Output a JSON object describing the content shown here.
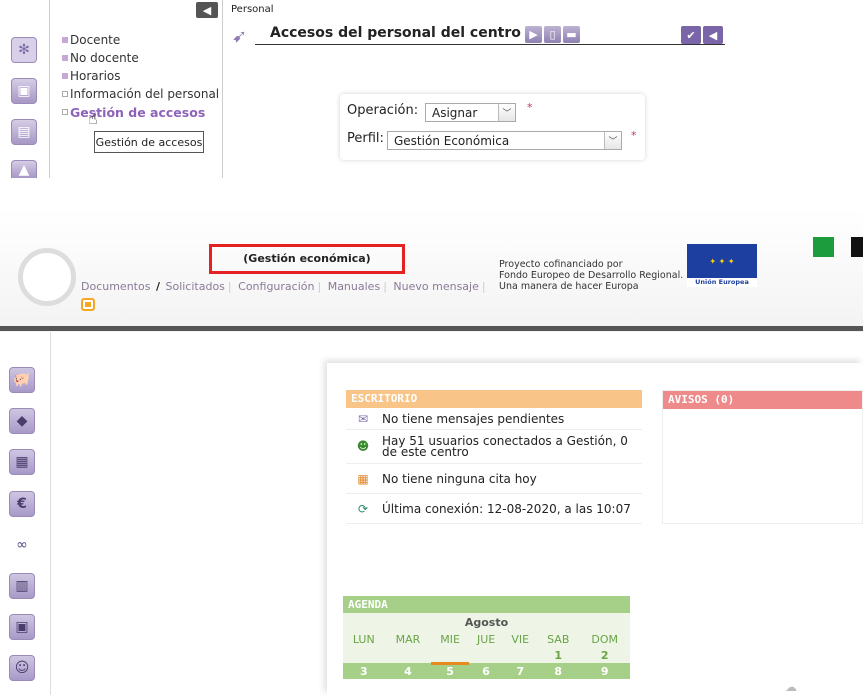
{
  "top": {
    "section": "Personal",
    "title": "Accesos del personal del centro",
    "menu": [
      {
        "label": "Docente",
        "color": "#c7a7d6"
      },
      {
        "label": "No docente",
        "color": "#c7a7d6"
      },
      {
        "label": "Horarios",
        "color": "#c7a7d6"
      },
      {
        "label": "Información del personal",
        "color": "#ffffff"
      },
      {
        "label": "Gestión de accesos",
        "color": "#ffffff",
        "active": true
      }
    ],
    "tooltip": "Gestión de accesos",
    "form": {
      "operacion_label": "Operación:",
      "operacion_value": "Asignar",
      "perfil_label": "Perfil:",
      "perfil_value": "Gestión Económica",
      "required_mark": "*"
    },
    "toolbar_icons": [
      "arrow-right-icon",
      "document-icon",
      "print-icon"
    ],
    "action_icons": [
      "check-icon",
      "back-icon"
    ],
    "left_icons": [
      "virus-icon",
      "school-icon",
      "id-card-icon",
      "graduation-icon"
    ]
  },
  "bottom": {
    "profile": "(Gestión económica)",
    "nav": [
      "Documentos",
      "Solicitados",
      "Configuración",
      "Manuales",
      "Nuevo mensaje"
    ],
    "nav_separator": "/",
    "eu_text": [
      "Proyecto cofinanciado por",
      "Fondo Europeo de Desarrollo Regional.",
      "Una manera de hacer Europa"
    ],
    "eu_label": "Unión Europea",
    "escritorio": {
      "title": "ESCRITORIO",
      "items": [
        {
          "icon": "mail-icon",
          "text": "No tiene mensajes pendientes"
        },
        {
          "icon": "users-icon",
          "text": "Hay 51 usuarios conectados a Gestión, 0 de este centro"
        },
        {
          "icon": "calendar-icon",
          "text": "No tiene ninguna cita hoy"
        },
        {
          "icon": "sync-icon",
          "text": "Última conexión: 12-08-2020, a las 10:07"
        }
      ]
    },
    "avisos": {
      "title": "AVISOS (0)"
    },
    "agenda": {
      "title": "AGENDA",
      "month": "Agosto",
      "days": [
        "LUN",
        "MAR",
        "MIE",
        "JUE",
        "VIE",
        "SAB",
        "DOM"
      ],
      "weeks": [
        [
          "",
          "",
          "",
          "",
          "",
          "1",
          "2"
        ],
        [
          "3",
          "4",
          "5",
          "6",
          "7",
          "8",
          "9"
        ]
      ]
    },
    "left_icons": [
      "piggy-bank-icon",
      "tag-icon",
      "calculator-icon",
      "euro-icon",
      "glasses-icon",
      "notebook-icon",
      "copy-icon",
      "support-icon"
    ],
    "colors": {
      "accent": "#8f80b2",
      "escritorio": "#f8c488",
      "avisos": "#ee8a8a",
      "agenda": "#a6cf88",
      "highlight": "#e52222"
    }
  }
}
